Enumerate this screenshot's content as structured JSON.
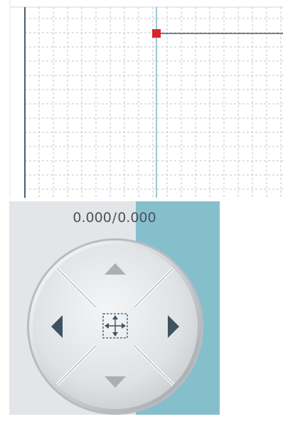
{
  "coordinates": {
    "x": "0.000",
    "separator": "/",
    "y": "0.000"
  },
  "canvas": {
    "background": "#ffffff",
    "grid_color": "#bfc4c8",
    "axis_color": "#4a5f6e",
    "cursor_color": "#7ab7c4",
    "marker_color": "#d9252a"
  },
  "jog_pad": {
    "buttons": [
      "up",
      "down",
      "left",
      "right",
      "center-move"
    ],
    "colors": {
      "panel_left": "#e3e5e8",
      "panel_right": "#86bfcc",
      "arrow_vertical": "#a9afb4",
      "arrow_horizontal": "#3e5361",
      "center_icon": "#3e5361"
    }
  }
}
